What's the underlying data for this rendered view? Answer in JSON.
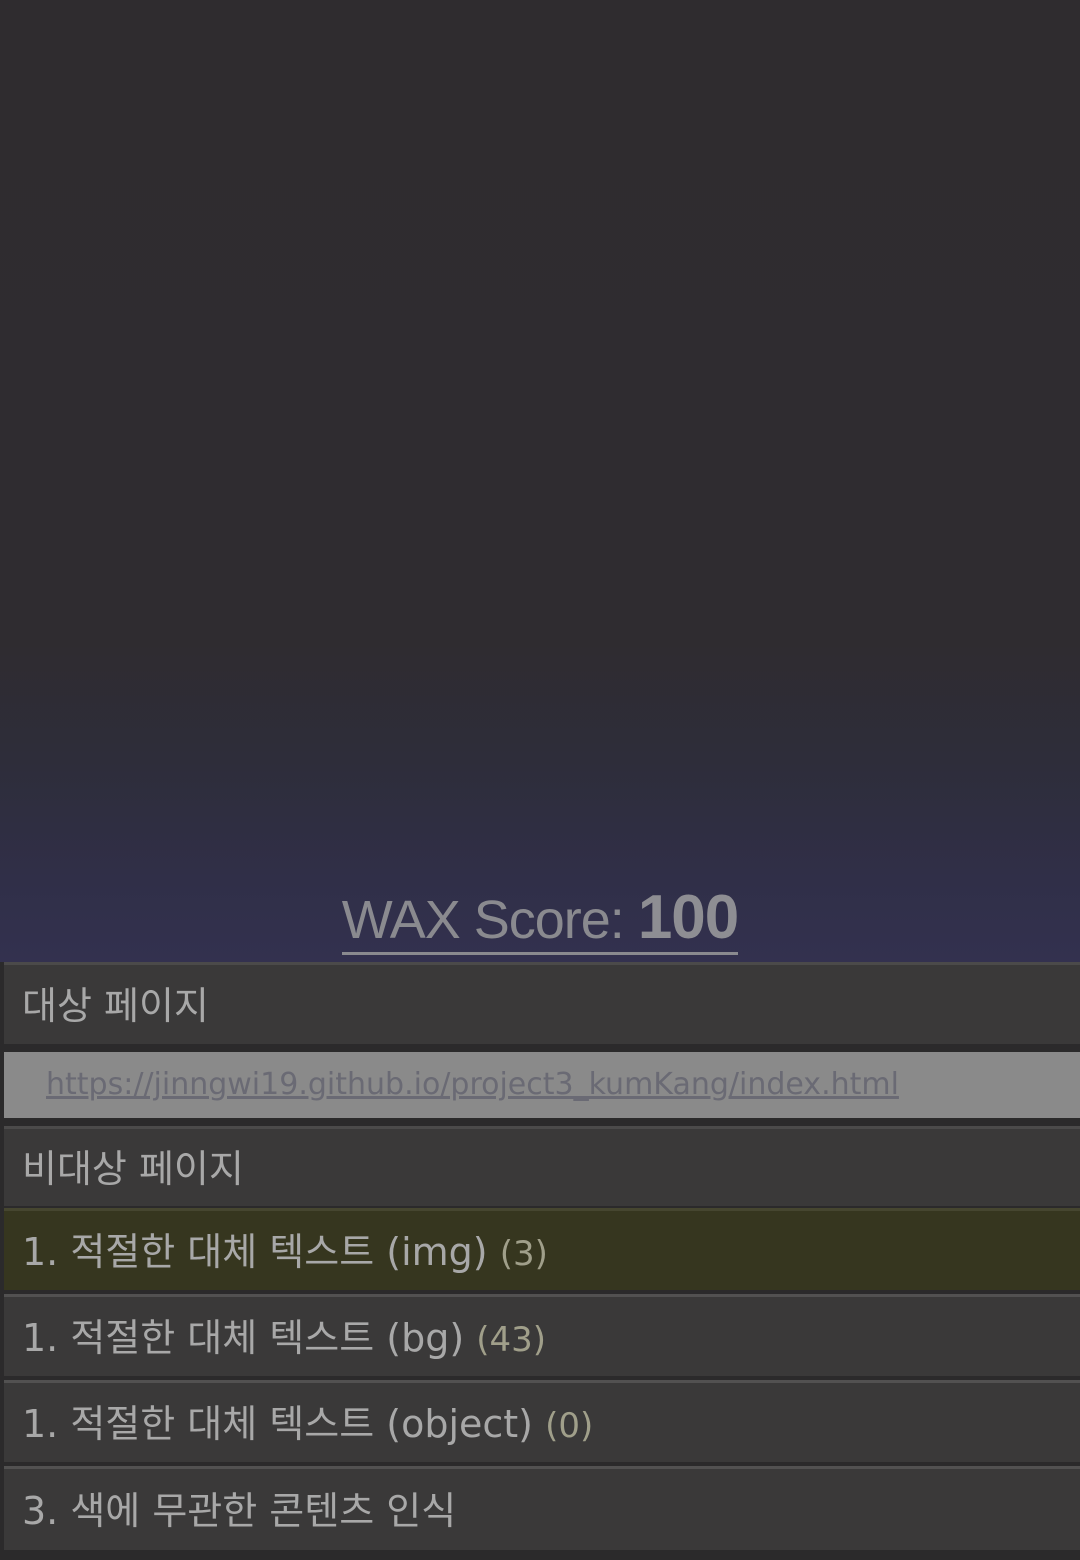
{
  "score": {
    "label": "WAX Score: ",
    "value": "100"
  },
  "panel": {
    "target_page_label": "대상 페이지",
    "target_url": "https://jinngwi19.github.io/project3_kumKang/index.html",
    "non_target_page_label": "비대상 페이지",
    "items": [
      {
        "label": "1. 적절한 대체 텍스트 (img)",
        "count": "(3)"
      },
      {
        "label": "1. 적절한 대체 텍스트 (bg)",
        "count": "(43)"
      },
      {
        "label": "1. 적절한 대체 텍스트 (object)",
        "count": "(0)"
      },
      {
        "label": "3. 색에 무관한 콘텐츠 인식",
        "count": ""
      }
    ]
  },
  "colors": {
    "background": "#2e2b2e",
    "gradient_bottom": "#33314f",
    "active_row": "#36361f",
    "url_bar": "#8a8a8a"
  }
}
